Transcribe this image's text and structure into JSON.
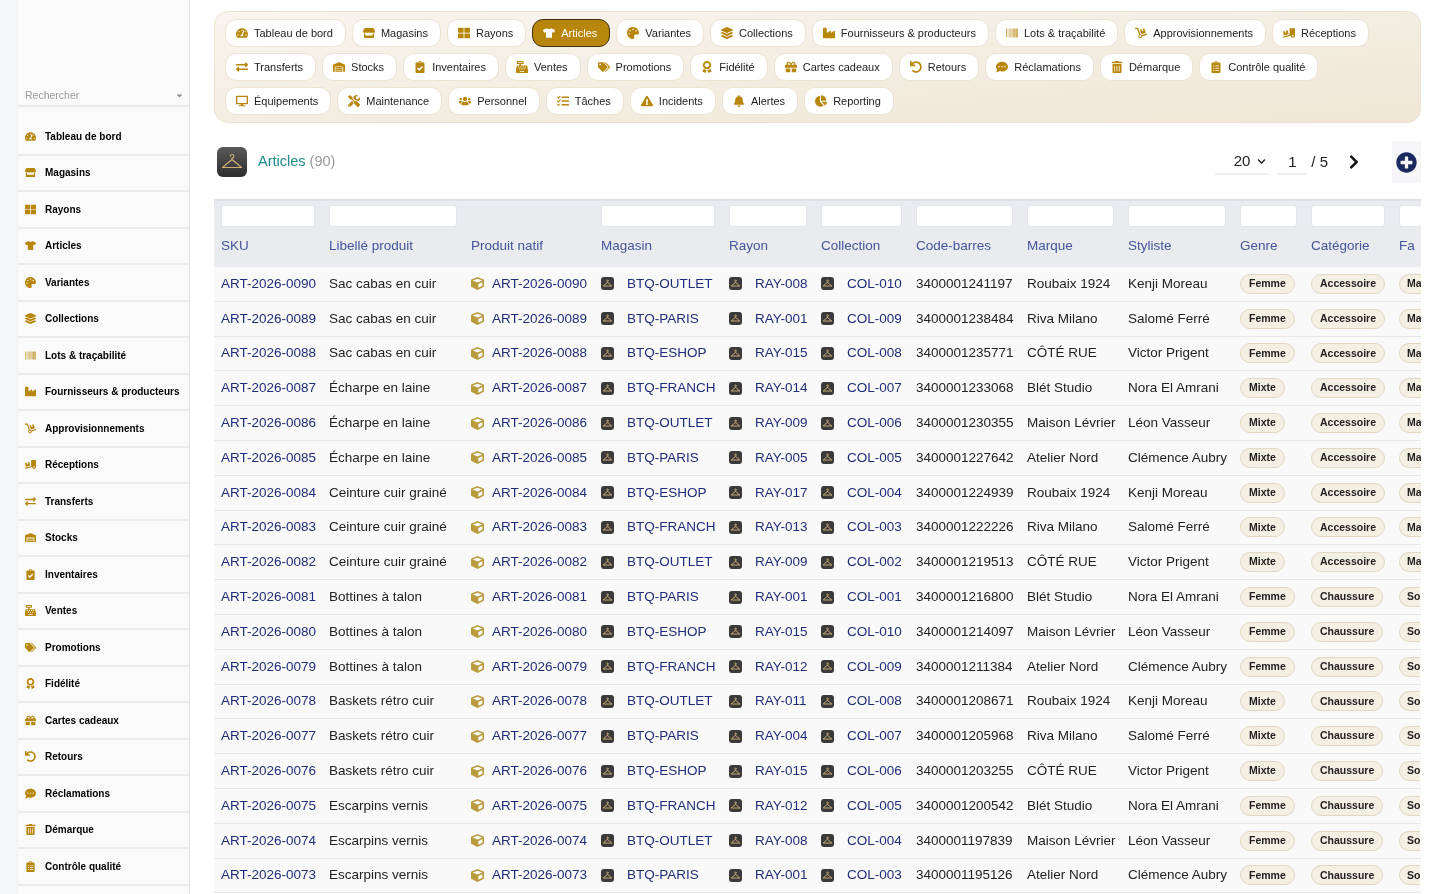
{
  "sidebar": {
    "search": {
      "placeholder": "Rechercher"
    },
    "items": [
      "Tableau de bord",
      "Magasins",
      "Rayons",
      "Articles",
      "Variantes",
      "Collections",
      "Lots & traçabilité",
      "Fournisseurs & producteurs",
      "Approvisionnements",
      "Réceptions",
      "Transferts",
      "Stocks",
      "Inventaires",
      "Ventes",
      "Promotions",
      "Fidélité",
      "Cartes cadeaux",
      "Retours",
      "Réclamations",
      "Démarque",
      "Contrôle qualité"
    ]
  },
  "nav": {
    "tabs": [
      {
        "label": "Tableau de bord",
        "selected": false
      },
      {
        "label": "Magasins",
        "selected": false
      },
      {
        "label": "Rayons",
        "selected": false
      },
      {
        "label": "Articles",
        "selected": true
      },
      {
        "label": "Variantes",
        "selected": false
      },
      {
        "label": "Collections",
        "selected": false
      },
      {
        "label": "Fournisseurs & producteurs",
        "selected": false
      },
      {
        "label": "Lots & traçabilité",
        "selected": false
      },
      {
        "label": "Approvisionnements",
        "selected": false
      },
      {
        "label": "Réceptions",
        "selected": false
      },
      {
        "label": "Transferts",
        "selected": false
      },
      {
        "label": "Stocks",
        "selected": false
      },
      {
        "label": "Inventaires",
        "selected": false
      },
      {
        "label": "Ventes",
        "selected": false
      },
      {
        "label": "Promotions",
        "selected": false
      },
      {
        "label": "Fidélité",
        "selected": false
      },
      {
        "label": "Cartes cadeaux",
        "selected": false
      },
      {
        "label": "Retours",
        "selected": false
      },
      {
        "label": "Réclamations",
        "selected": false
      },
      {
        "label": "Démarque",
        "selected": false
      },
      {
        "label": "Contrôle qualité",
        "selected": false
      },
      {
        "label": "Équipements",
        "selected": false
      },
      {
        "label": "Maintenance",
        "selected": false
      },
      {
        "label": "Personnel",
        "selected": false
      },
      {
        "label": "Tâches",
        "selected": false
      },
      {
        "label": "Incidents",
        "selected": false
      },
      {
        "label": "Alertes",
        "selected": false
      },
      {
        "label": "Reporting",
        "selected": false
      }
    ]
  },
  "header": {
    "title": "Articles",
    "count": "(90)",
    "page_size": "20",
    "page": "1",
    "total_pages": "/ 5"
  },
  "table": {
    "columns": [
      {
        "label": "SKU",
        "kind": "link",
        "filter": true
      },
      {
        "label": "Libellé produit",
        "kind": "text",
        "filter": true
      },
      {
        "label": "Produit natif",
        "kind": "icon-link",
        "filter": false
      },
      {
        "label": "Magasin",
        "kind": "tile-link",
        "filter": true
      },
      {
        "label": "Rayon",
        "kind": "tile-link",
        "filter": true
      },
      {
        "label": "Collection",
        "kind": "tile-link",
        "filter": true
      },
      {
        "label": "Code-barres",
        "kind": "text",
        "filter": true
      },
      {
        "label": "Marque",
        "kind": "text",
        "filter": true
      },
      {
        "label": "Styliste",
        "kind": "text",
        "filter": true
      },
      {
        "label": "Genre",
        "kind": "tag",
        "filter": true
      },
      {
        "label": "Catégorie",
        "kind": "tag",
        "filter": true
      },
      {
        "label": "Fa",
        "kind": "tag",
        "filter": true
      }
    ],
    "rows": [
      [
        "ART-2026-0090",
        "Sac cabas en cuir",
        "ART-2026-0090",
        "BTQ-OUTLET",
        "RAY-008",
        "COL-010",
        "3400001241197",
        "Roubaix 1924",
        "Kenji Moreau",
        "Femme",
        "Accessoire",
        "Ma"
      ],
      [
        "ART-2026-0089",
        "Sac cabas en cuir",
        "ART-2026-0089",
        "BTQ-PARIS",
        "RAY-001",
        "COL-009",
        "3400001238484",
        "Riva Milano",
        "Salomé Ferré",
        "Femme",
        "Accessoire",
        "Ma"
      ],
      [
        "ART-2026-0088",
        "Sac cabas en cuir",
        "ART-2026-0088",
        "BTQ-ESHOP",
        "RAY-015",
        "COL-008",
        "3400001235771",
        "CÔTÉ RUE",
        "Victor Prigent",
        "Femme",
        "Accessoire",
        "Ma"
      ],
      [
        "ART-2026-0087",
        "Écharpe en laine",
        "ART-2026-0087",
        "BTQ-FRANCH",
        "RAY-014",
        "COL-007",
        "3400001233068",
        "Blét Studio",
        "Nora El Amrani",
        "Mixte",
        "Accessoire",
        "Ma"
      ],
      [
        "ART-2026-0086",
        "Écharpe en laine",
        "ART-2026-0086",
        "BTQ-OUTLET",
        "RAY-009",
        "COL-006",
        "3400001230355",
        "Maison Lévrier",
        "Léon Vasseur",
        "Mixte",
        "Accessoire",
        "Ma"
      ],
      [
        "ART-2026-0085",
        "Écharpe en laine",
        "ART-2026-0085",
        "BTQ-PARIS",
        "RAY-005",
        "COL-005",
        "3400001227642",
        "Atelier Nord",
        "Clémence Aubry",
        "Mixte",
        "Accessoire",
        "Ma"
      ],
      [
        "ART-2026-0084",
        "Ceinture cuir grainé",
        "ART-2026-0084",
        "BTQ-ESHOP",
        "RAY-017",
        "COL-004",
        "3400001224939",
        "Roubaix 1924",
        "Kenji Moreau",
        "Mixte",
        "Accessoire",
        "Ma"
      ],
      [
        "ART-2026-0083",
        "Ceinture cuir grainé",
        "ART-2026-0083",
        "BTQ-FRANCH",
        "RAY-013",
        "COL-003",
        "3400001222226",
        "Riva Milano",
        "Salomé Ferré",
        "Mixte",
        "Accessoire",
        "Ma"
      ],
      [
        "ART-2026-0082",
        "Ceinture cuir grainé",
        "ART-2026-0082",
        "BTQ-OUTLET",
        "RAY-009",
        "COL-002",
        "3400001219513",
        "CÔTÉ RUE",
        "Victor Prigent",
        "Mixte",
        "Accessoire",
        "Ma"
      ],
      [
        "ART-2026-0081",
        "Bottines à talon",
        "ART-2026-0081",
        "BTQ-PARIS",
        "RAY-001",
        "COL-001",
        "3400001216800",
        "Blét Studio",
        "Nora El Amrani",
        "Femme",
        "Chaussure",
        "So"
      ],
      [
        "ART-2026-0080",
        "Bottines à talon",
        "ART-2026-0080",
        "BTQ-ESHOP",
        "RAY-015",
        "COL-010",
        "3400001214097",
        "Maison Lévrier",
        "Léon Vasseur",
        "Femme",
        "Chaussure",
        "So"
      ],
      [
        "ART-2026-0079",
        "Bottines à talon",
        "ART-2026-0079",
        "BTQ-FRANCH",
        "RAY-012",
        "COL-009",
        "3400001211384",
        "Atelier Nord",
        "Clémence Aubry",
        "Femme",
        "Chaussure",
        "So"
      ],
      [
        "ART-2026-0078",
        "Baskets rétro cuir",
        "ART-2026-0078",
        "BTQ-OUTLET",
        "RAY-011",
        "COL-008",
        "3400001208671",
        "Roubaix 1924",
        "Kenji Moreau",
        "Mixte",
        "Chaussure",
        "So"
      ],
      [
        "ART-2026-0077",
        "Baskets rétro cuir",
        "ART-2026-0077",
        "BTQ-PARIS",
        "RAY-004",
        "COL-007",
        "3400001205968",
        "Riva Milano",
        "Salomé Ferré",
        "Mixte",
        "Chaussure",
        "So"
      ],
      [
        "ART-2026-0076",
        "Baskets rétro cuir",
        "ART-2026-0076",
        "BTQ-ESHOP",
        "RAY-015",
        "COL-006",
        "3400001203255",
        "CÔTÉ RUE",
        "Victor Prigent",
        "Mixte",
        "Chaussure",
        "So"
      ],
      [
        "ART-2026-0075",
        "Escarpins vernis",
        "ART-2026-0075",
        "BTQ-FRANCH",
        "RAY-012",
        "COL-005",
        "3400001200542",
        "Blét Studio",
        "Nora El Amrani",
        "Femme",
        "Chaussure",
        "So"
      ],
      [
        "ART-2026-0074",
        "Escarpins vernis",
        "ART-2026-0074",
        "BTQ-OUTLET",
        "RAY-008",
        "COL-004",
        "3400001197839",
        "Maison Lévrier",
        "Léon Vasseur",
        "Femme",
        "Chaussure",
        "So"
      ],
      [
        "ART-2026-0073",
        "Escarpins vernis",
        "ART-2026-0073",
        "BTQ-PARIS",
        "RAY-001",
        "COL-003",
        "3400001195126",
        "Atelier Nord",
        "Clémence Aubry",
        "Femme",
        "Chaussure",
        "So"
      ]
    ]
  }
}
